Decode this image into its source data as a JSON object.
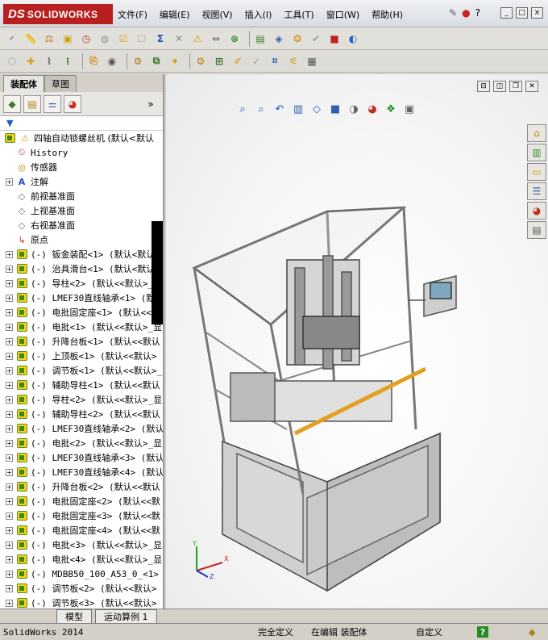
{
  "app": {
    "logo_prefix": "DS",
    "logo_name": "SOLIDWORKS"
  },
  "menu": [
    "文件(F)",
    "编辑(E)",
    "视图(V)",
    "插入(I)",
    "工具(T)",
    "窗口(W)",
    "帮助(H)"
  ],
  "window_controls": [
    "_",
    "□",
    "×"
  ],
  "panel_tabs": {
    "assembly": "装配体",
    "sketch": "草图"
  },
  "filter": {
    "icon": "filter-icon"
  },
  "tree": {
    "root": "四轴自动锁螺丝机  (默认<默认",
    "items": [
      {
        "type": "history",
        "label": "History"
      },
      {
        "type": "sensor",
        "label": "传感器"
      },
      {
        "type": "annotation",
        "label": "注解"
      },
      {
        "type": "plane",
        "label": "前视基准面"
      },
      {
        "type": "plane",
        "label": "上视基准面"
      },
      {
        "type": "plane",
        "label": "右视基准面"
      },
      {
        "type": "origin",
        "label": "原点"
      }
    ],
    "parts": [
      "(-) 钣金装配<1> (默认<默认_",
      "(-) 治具滑台<1> (默认<默认_",
      "(-) 导柱<2> (默认<<默认>_显",
      "(-) LMEF30直线轴承<1> (默认",
      "(-) 电批固定座<1> (默认<<默",
      "(-) 电批<1> (默认<<默认>_显",
      "(-) 升降台板<1> (默认<<默认",
      "(-) 上顶板<1> (默认<<默认>",
      "(-) 调节板<1> (默认<<默认>_",
      "(-) 辅助导柱<1> (默认<<默认",
      "(-) 导柱<2> (默认<<默认>_显",
      "(-) 辅助导柱<2> (默认<<默认",
      "(-) LMEF30直线轴承<2> (默认",
      "(-) 电批<2> (默认<<默认>_显",
      "(-) LMEF30直线轴承<3> (默认",
      "(-) LMEF30直线轴承<4> (默认",
      "(-) 升降台板<2> (默认<<默认",
      "(-) 电批固定座<2> (默认<<默",
      "(-) 电批固定座<3> (默认<<默",
      "(-) 电批固定座<4> (默认<<默",
      "(-) 电批<3> (默认<<默认>_显",
      "(-) 电批<4> (默认<<默认>_显",
      "(-) MDBB50_100_A53_0_<1> (",
      "(-) 调节板<2> (默认<<默认>",
      "(-) 调节板<3> (默认<<默认>"
    ]
  },
  "bottom_tabs": [
    "模型",
    "运动算例 1"
  ],
  "status": {
    "app_version": "SolidWorks 2014",
    "constraint": "完全定义",
    "mode": "在编辑 装配体",
    "custom": "自定义",
    "help": "?"
  }
}
